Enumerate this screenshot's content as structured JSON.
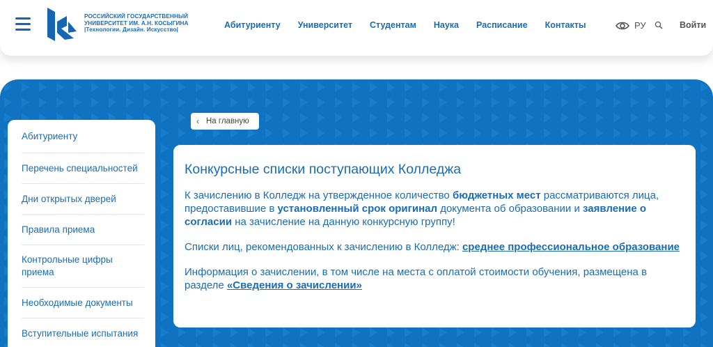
{
  "header": {
    "logo_text": [
      "РОССИЙСКИЙ ГОСУДАРСТВЕННЫЙ",
      "УНИВЕРСИТЕТ ИМ. А.Н. КОСЫГИНА",
      "|Технологии. Дизайн. Искусство|"
    ],
    "nav": [
      "Абитуриенту",
      "Университет",
      "Студентам",
      "Наука",
      "Расписание",
      "Контакты"
    ],
    "lang": "РУ",
    "login": "Войти",
    "brand_color": "#1a6cb6"
  },
  "back_button": "На главную",
  "sidebar": {
    "items": [
      "Абитуриенту",
      "Перечень специальностей",
      "Дни открытых дверей",
      "Правила приема",
      "Контрольные цифры приема",
      "Необходимые документы",
      "Вступительные испытания"
    ]
  },
  "content": {
    "title": "Конкурсные списки поступающих Колледжа",
    "p1": {
      "t1": "К зачислению в Колледж на утвержденное количество ",
      "b1": "бюджетных мест",
      "t2": " рассматриваются лица, предоставившие в ",
      "b2": "установленный срок оригинал",
      "t3": " документа об образовании и ",
      "b3": "заявление о согласии",
      "t4": " на зачисление на данную конкурсную группу!"
    },
    "p2": {
      "t1": "Списки лиц, рекомендованных к зачислению в Колледж: ",
      "link": "среднее профессиональное образование"
    },
    "p3": {
      "t1": "Информация о зачислении, в том числе на места с оплатой стоимости обучения, размещена в разделе ",
      "link": "«Сведения о зачислении»"
    }
  },
  "colors": {
    "band": "#0f73c2",
    "text": "#1a6cb6"
  }
}
